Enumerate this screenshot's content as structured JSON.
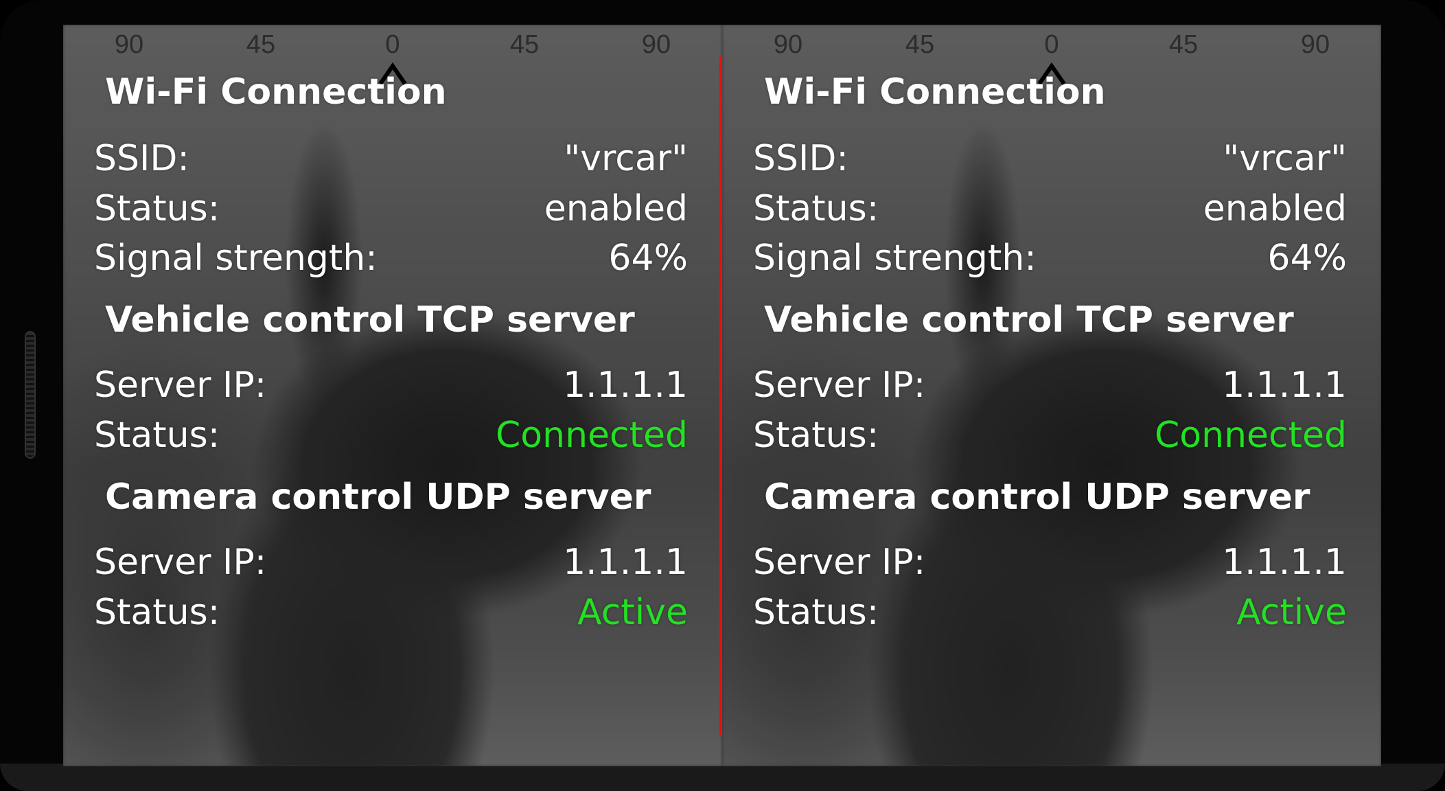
{
  "compass": {
    "ticks": [
      "90",
      "45",
      "0",
      "45",
      "90"
    ]
  },
  "wifi": {
    "title": "Wi-Fi Connection",
    "ssid_label": "SSID:",
    "ssid_value": "\"vrcar\"",
    "status_label": "Status:",
    "status_value": "enabled",
    "signal_label": "Signal strength:",
    "signal_value": "64%"
  },
  "tcp": {
    "title": "Vehicle control TCP server",
    "ip_label": "Server IP:",
    "ip_value": "1.1.1.1",
    "status_label": "Status:",
    "status_value": "Connected"
  },
  "udp": {
    "title": "Camera control UDP server",
    "ip_label": "Server IP:",
    "ip_value": "1.1.1.1",
    "status_label": "Status:",
    "status_value": "Active"
  },
  "colors": {
    "divider": "#e8100f",
    "status_ok": "#23e123",
    "text": "#ffffff",
    "compass_text": "#2c2c2c"
  }
}
